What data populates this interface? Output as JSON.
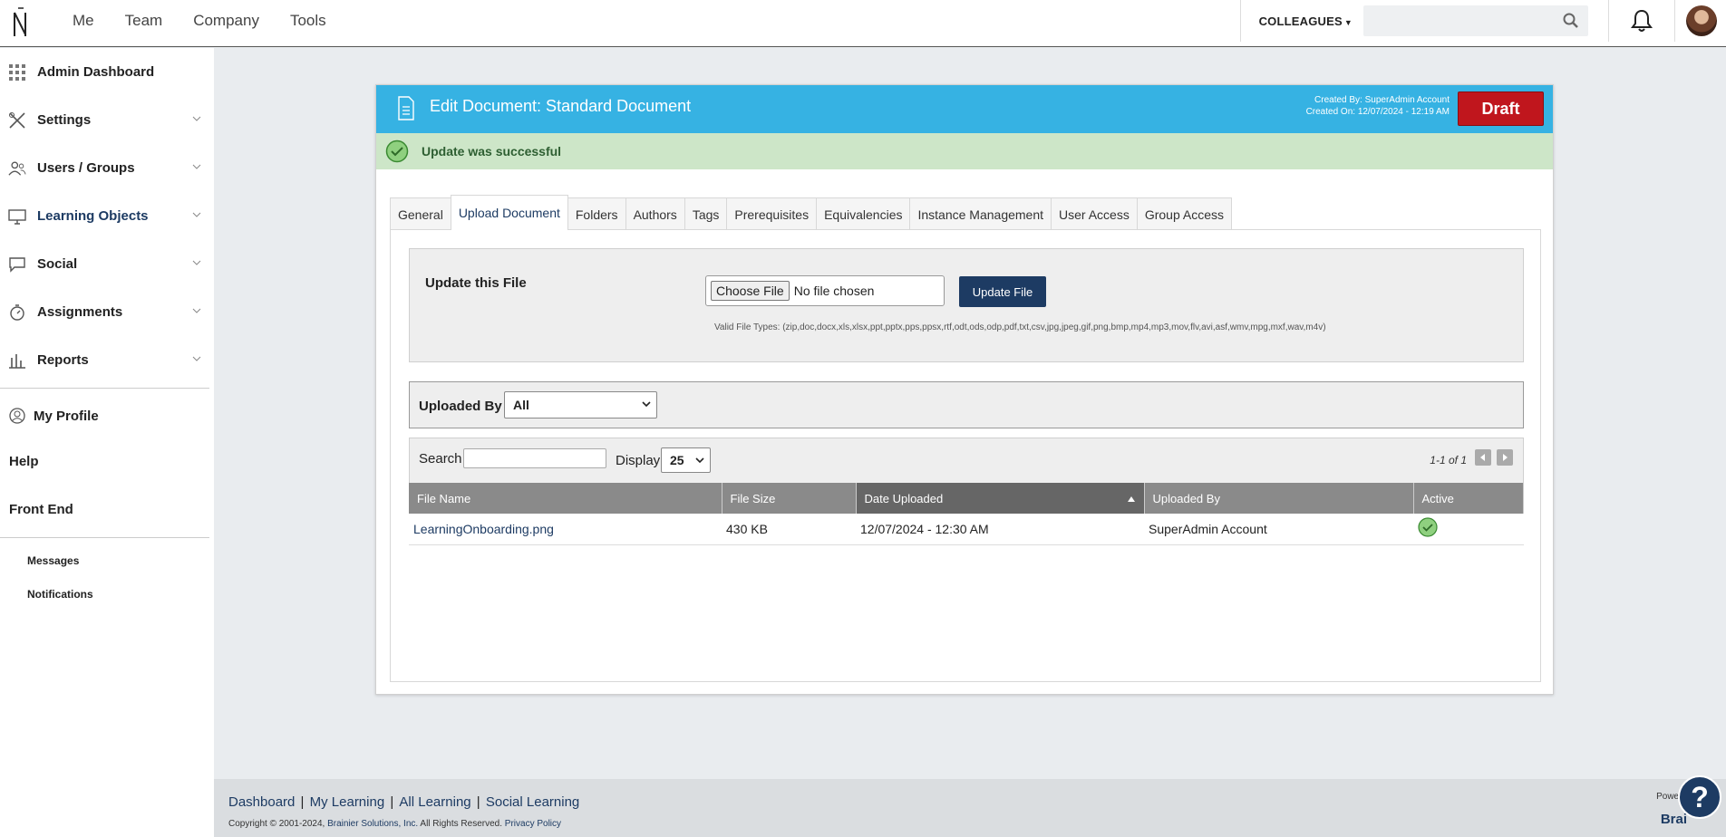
{
  "topnav": {
    "items": [
      "Me",
      "Team",
      "Company",
      "Tools"
    ],
    "colleagues_label": "COLLEAGUES",
    "search_placeholder": ""
  },
  "sidebar": {
    "items": [
      {
        "label": "Admin Dashboard",
        "icon": "grid-icon"
      },
      {
        "label": "Settings",
        "icon": "tools-icon"
      },
      {
        "label": "Users / Groups",
        "icon": "users-icon"
      },
      {
        "label": "Learning Objects",
        "icon": "monitor-icon"
      },
      {
        "label": "Social",
        "icon": "chat-icon"
      },
      {
        "label": "Assignments",
        "icon": "stopwatch-icon"
      },
      {
        "label": "Reports",
        "icon": "bar-chart-icon"
      }
    ],
    "my_profile": "My Profile",
    "help": "Help",
    "front_end": "Front End",
    "messages": "Messages",
    "notifications": "Notifications"
  },
  "panel": {
    "title": "Edit Document: Standard Document",
    "created_by": "Created By: SuperAdmin Account",
    "created_on": "Created On: 12/07/2024 - 12:19 AM",
    "status": "Draft",
    "success_message": "Update was successful"
  },
  "tabs": [
    "General",
    "Upload Document",
    "Folders",
    "Authors",
    "Tags",
    "Prerequisites",
    "Equivalencies",
    "Instance Management",
    "User Access",
    "Group Access"
  ],
  "upload": {
    "label": "Update this File",
    "choose_button": "Choose File",
    "no_file": "No file chosen",
    "update_button": "Update File",
    "valid_types": "Valid File Types: (zip,doc,docx,xls,xlsx,ppt,pptx,pps,ppsx,rtf,odt,ods,odp,pdf,txt,csv,jpg,jpeg,gif,png,bmp,mp4,mp3,mov,flv,avi,asf,wmv,mpg,mxf,wav,m4v)"
  },
  "filter": {
    "label": "Uploaded By",
    "selected": "All"
  },
  "grid": {
    "search_label": "Search",
    "display_label": "Display",
    "display_value": "25",
    "pager_text": "1-1 of 1",
    "columns": [
      "File Name",
      "File Size",
      "Date Uploaded",
      "Uploaded By",
      "Active"
    ],
    "rows": [
      {
        "file_name": "LearningOnboarding.png",
        "file_size": "430 KB",
        "date_uploaded": "12/07/2024 - 12:30 AM",
        "uploaded_by": "SuperAdmin Account",
        "active": true
      }
    ]
  },
  "footer": {
    "links": [
      "Dashboard",
      "My Learning",
      "All Learning",
      "Social Learning"
    ],
    "copyright_prefix": "Copyright © 2001-2024, ",
    "company": "Brainier Solutions, Inc.",
    "rights": " All Rights Reserved. ",
    "privacy": "Privacy Policy",
    "powered": "Powere",
    "brand": "Brai"
  },
  "help_button": "?",
  "colors": {
    "header_blue": "#36b2e3",
    "draft_red": "#c0161d",
    "navy": "#1d3b63",
    "success_bg": "#cde6c8"
  }
}
